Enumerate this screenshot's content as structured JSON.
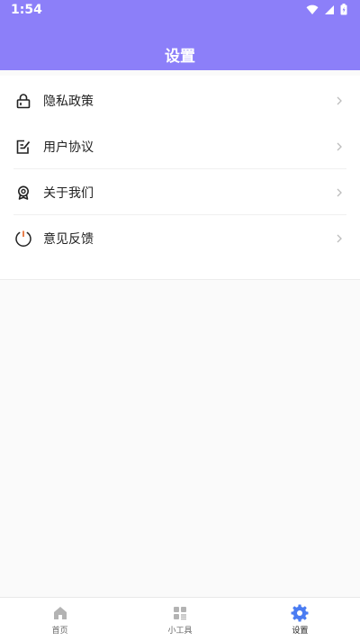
{
  "status_bar": {
    "time": "1:54",
    "icons": [
      "wifi-icon",
      "signal-icon",
      "battery-icon"
    ]
  },
  "header": {
    "title": "设置",
    "background_color": "#8c7ff9"
  },
  "settings": {
    "items": [
      {
        "label": "隐私政策",
        "icon": "lock-icon"
      },
      {
        "label": "用户协议",
        "icon": "edit-document-icon"
      },
      {
        "label": "关于我们",
        "icon": "badge-icon"
      },
      {
        "label": "意见反馈",
        "icon": "power-timer-icon"
      }
    ]
  },
  "bottom_nav": {
    "items": [
      {
        "label": "首页",
        "icon": "home-icon",
        "active": false
      },
      {
        "label": "小工具",
        "icon": "tools-grid-icon",
        "active": false
      },
      {
        "label": "设置",
        "icon": "gear-icon",
        "active": true
      }
    ],
    "active_color": "#4a7cf2"
  }
}
